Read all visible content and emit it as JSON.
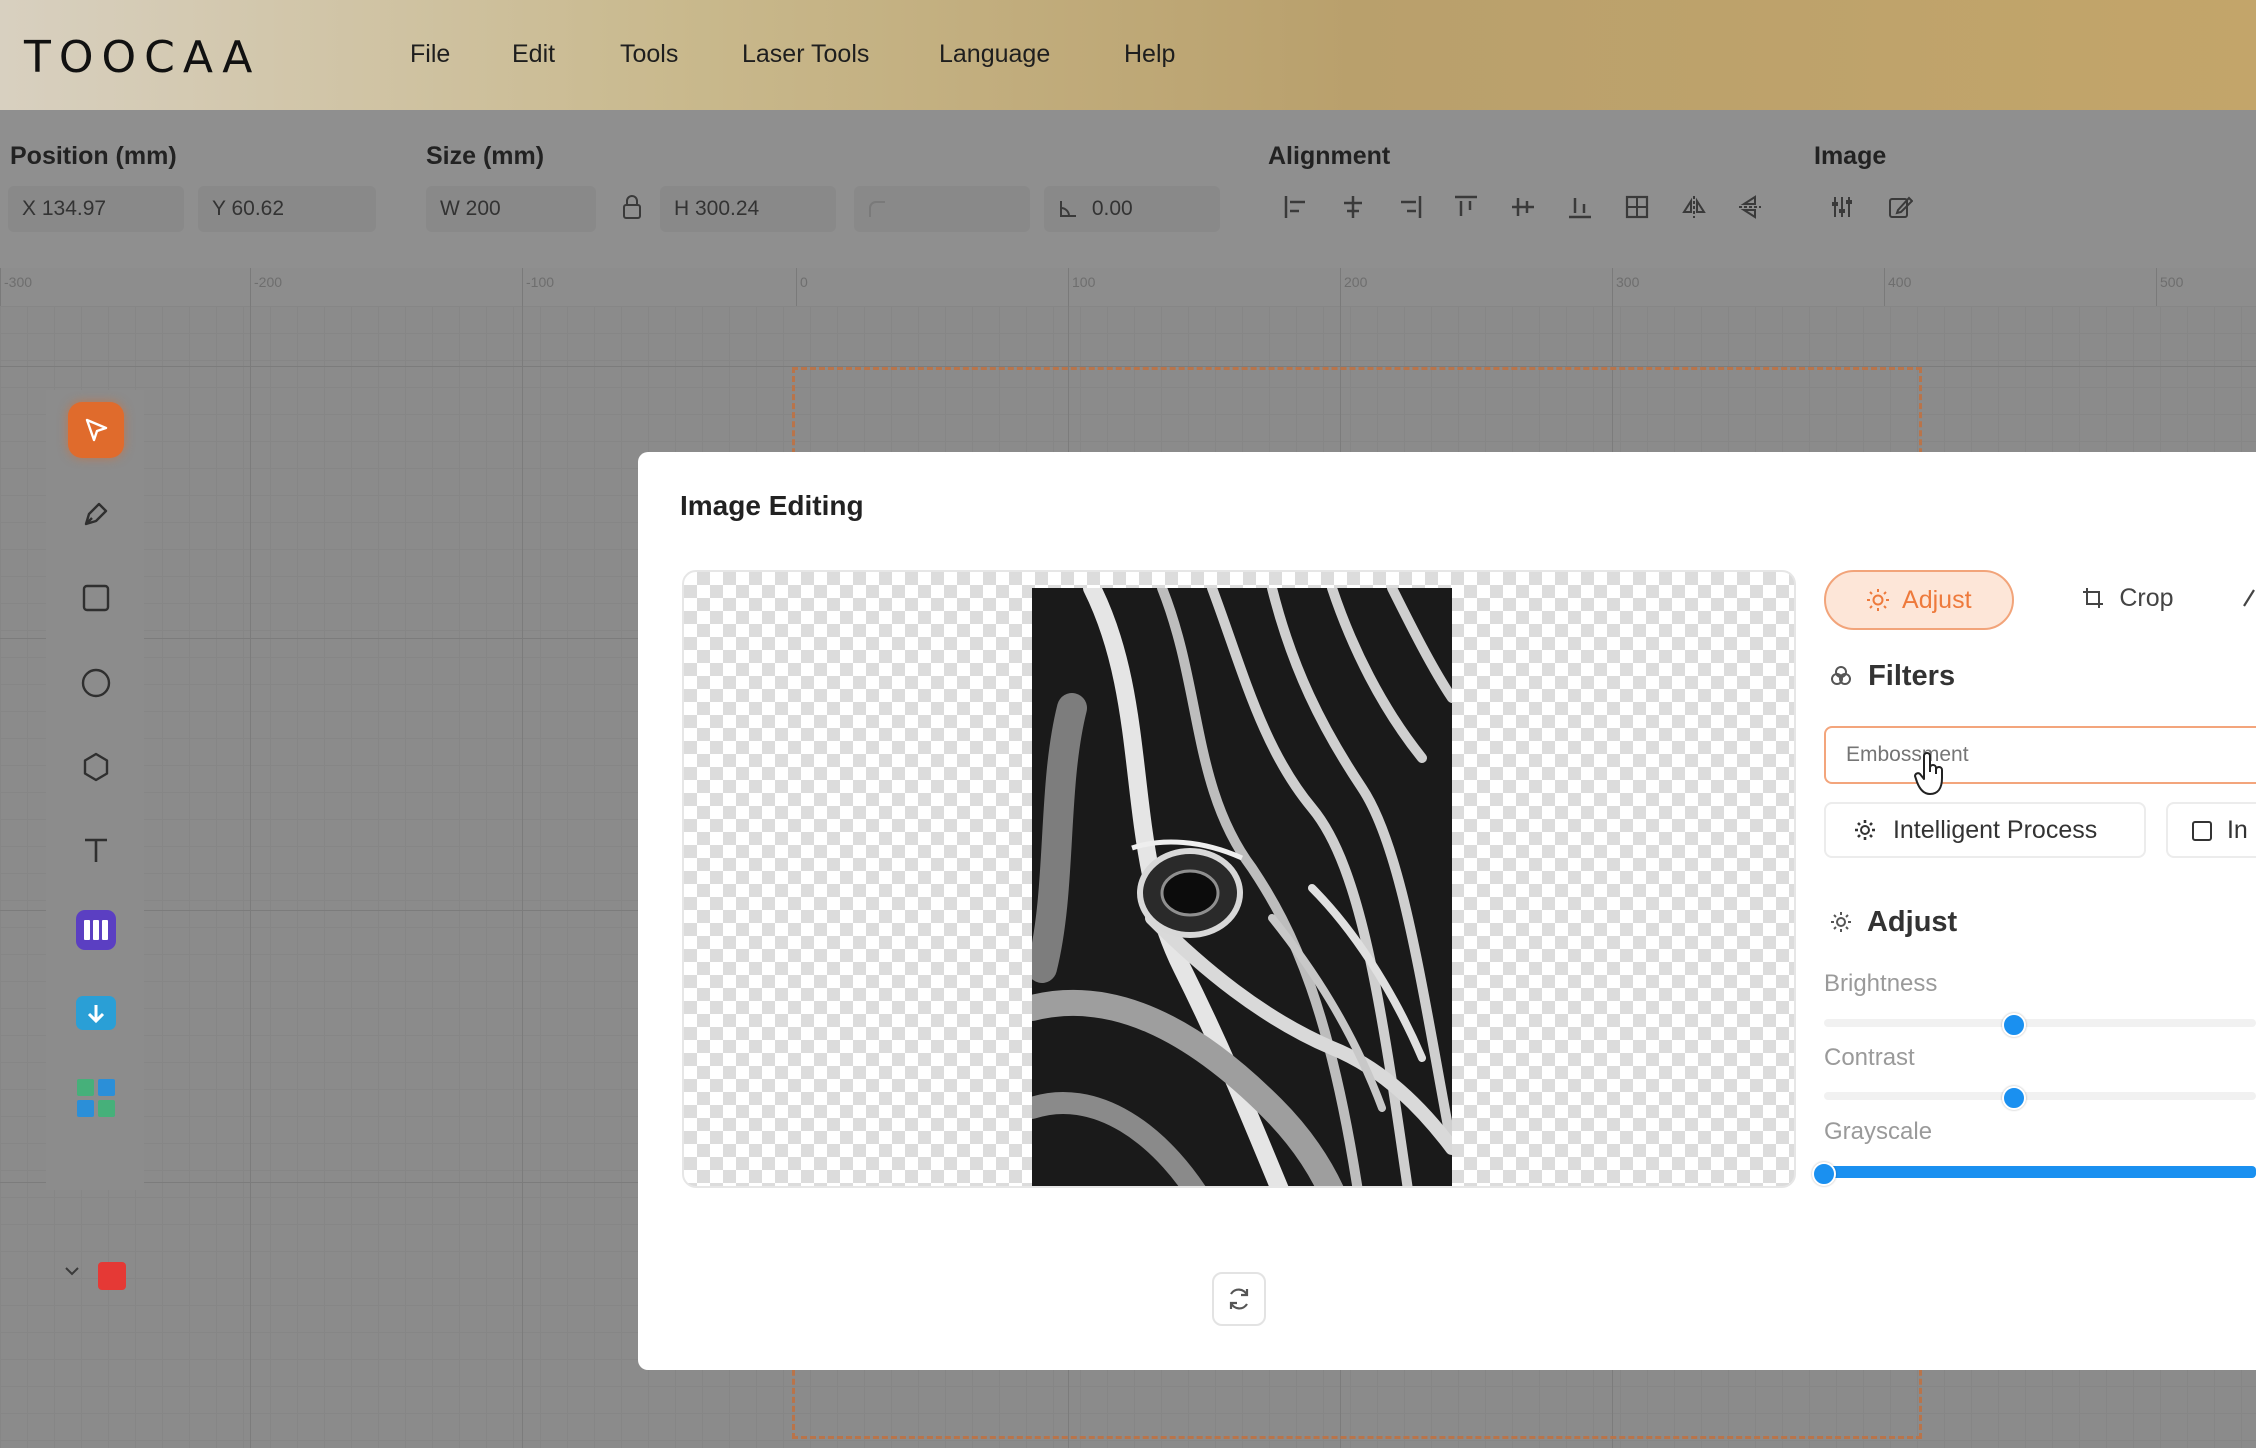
{
  "app": {
    "logo": "TOOCAA"
  },
  "menu": [
    "File",
    "Edit",
    "Tools",
    "Laser Tools",
    "Language",
    "Help"
  ],
  "toolbar": {
    "position_label": "Position (mm)",
    "x_value": "X 134.97",
    "y_value": "Y 60.62",
    "size_label": "Size (mm)",
    "w_value": "W 200",
    "h_value": "H 300.24",
    "angle_value": "0.00",
    "alignment_label": "Alignment",
    "image_label": "Image"
  },
  "ruler": [
    "-300",
    "-200",
    "-100",
    "0",
    "100",
    "200",
    "300",
    "400",
    "500"
  ],
  "dialog": {
    "title": "Image Editing",
    "tabs": {
      "adjust": "Adjust",
      "crop": "Crop"
    },
    "filters_title": "Filters",
    "filter_placeholder": "Embossment",
    "intelligent_process": "Intelligent Process",
    "invert_partial": "In",
    "adjust_title": "Adjust",
    "sliders": {
      "brightness": {
        "label": "Brightness",
        "value": 0.44
      },
      "contrast": {
        "label": "Contrast",
        "value": 0.44
      },
      "grayscale": {
        "label": "Grayscale",
        "value": 0.0
      }
    }
  },
  "colors": {
    "accent": "#ee7a3c",
    "slider": "#1a90f0",
    "layer_color": "#e53935"
  }
}
